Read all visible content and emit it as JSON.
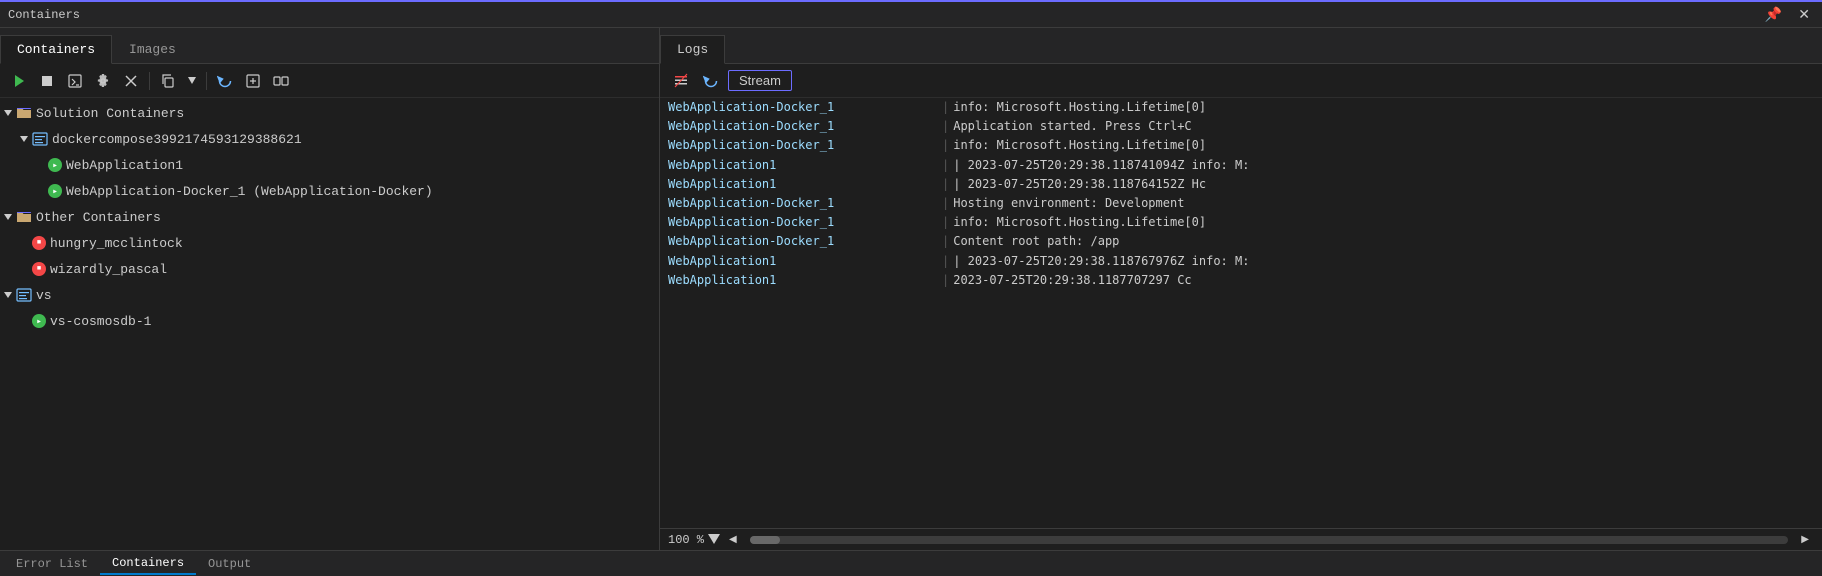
{
  "titleBar": {
    "title": "Containers",
    "pinIcon": "📌",
    "closeIcon": "✕"
  },
  "leftPanel": {
    "tabs": [
      {
        "id": "containers",
        "label": "Containers",
        "active": true
      },
      {
        "id": "images",
        "label": "Images",
        "active": false
      }
    ],
    "toolbar": {
      "runBtn": "▶",
      "stopBtn": "■",
      "terminalBtn": "⊡",
      "settingsBtn": "⚙",
      "deleteBtn": "✕",
      "copyBtn": "⧉",
      "separatorAfterCopy": true,
      "refreshBtn": "↺",
      "attachBtn": "⊞",
      "detachBtn": "⊟"
    },
    "tree": {
      "sections": [
        {
          "id": "solution-containers",
          "label": "Solution Containers",
          "icon": "folder",
          "expanded": true,
          "children": [
            {
              "id": "dockercompose",
              "label": "dockercompose399217459312938862​1",
              "icon": "compose",
              "expanded": true,
              "children": [
                {
                  "id": "webapp1",
                  "label": "WebApplication1",
                  "icon": "green",
                  "children": []
                },
                {
                  "id": "webapp-docker",
                  "label": "WebApplication-Docker_1 (WebApplication-Docker)",
                  "icon": "green",
                  "children": []
                }
              ]
            }
          ]
        },
        {
          "id": "other-containers",
          "label": "Other Containers",
          "icon": "folder",
          "expanded": true,
          "children": [
            {
              "id": "hungry",
              "label": "hungry_mcclintock",
              "icon": "red",
              "children": []
            },
            {
              "id": "wizardly",
              "label": "wizardly_pascal",
              "icon": "red",
              "children": []
            }
          ]
        },
        {
          "id": "vs",
          "label": "vs",
          "icon": "compose",
          "expanded": true,
          "children": [
            {
              "id": "vs-cosmosdb",
              "label": "vs-cosmosdb-1",
              "icon": "green",
              "children": []
            }
          ]
        }
      ]
    }
  },
  "rightPanel": {
    "tab": "Logs",
    "toolbar": {
      "filterBtn": "filter",
      "refreshBtn": "↺",
      "streamBtn": "Stream"
    },
    "logs": [
      {
        "source": "WebApplication-Docker_1",
        "separator": "|",
        "text": "info: Microsoft.Hosting.Lifetime[0]"
      },
      {
        "source": "WebApplication-Docker_1",
        "separator": "|",
        "text": "     Application started. Press Ctrl+C"
      },
      {
        "source": "WebApplication-Docker_1",
        "separator": "|",
        "text": "info: Microsoft.Hosting.Lifetime[0]"
      },
      {
        "source": "WebApplication1",
        "separator": "|",
        "text": "| 2023-07-25T20:29:38.118741094Z info: M:"
      },
      {
        "source": "WebApplication1",
        "separator": "|",
        "text": "| 2023-07-25T20:29:38.118764152Z       Hc"
      },
      {
        "source": "WebApplication-Docker_1",
        "separator": "|",
        "text": "     Hosting environment: Development"
      },
      {
        "source": "WebApplication-Docker_1",
        "separator": "|",
        "text": "info: Microsoft.Hosting.Lifetime[0]"
      },
      {
        "source": "WebApplication-Docker_1",
        "separator": "|",
        "text": "     Content root path: /app"
      },
      {
        "source": "WebApplication1",
        "separator": "|",
        "text": "| 2023-07-25T20:29:38.118767976Z info: M:"
      },
      {
        "source": "WebApplication1",
        "separator": "|",
        "text": "2023-07-25T20:29:38.118770729​7          Cc"
      }
    ],
    "statusBar": {
      "zoom": "100 %",
      "scrollLeft": "◀",
      "scrollRight": "▶"
    }
  },
  "bottomTabs": [
    {
      "id": "error-list",
      "label": "Error List",
      "active": false
    },
    {
      "id": "containers",
      "label": "Containers",
      "active": true
    },
    {
      "id": "output",
      "label": "Output",
      "active": false
    }
  ]
}
